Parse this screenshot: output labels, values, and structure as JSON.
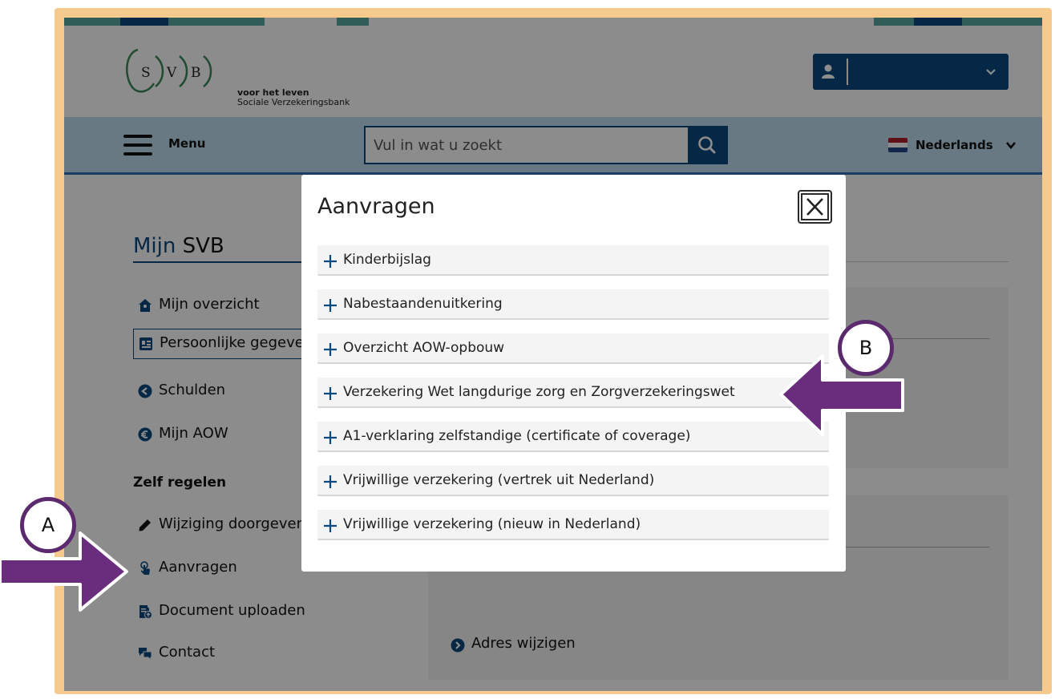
{
  "header": {
    "logo": {
      "letters": [
        "S",
        "V",
        "B"
      ],
      "tagline": "voor het leven",
      "org_name": "Sociale Verzekeringsbank"
    },
    "user_menu": {
      "icon": "user-icon",
      "chevron": "chevron-down-icon"
    }
  },
  "navbar": {
    "menu_label": "Menu",
    "search_placeholder": "Vul in wat u zoekt",
    "language_label": "Nederlands"
  },
  "sidebar": {
    "title_prefix": "Mijn",
    "title_strong": "SVB",
    "items": [
      {
        "label": "Mijn overzicht",
        "icon": "home-icon"
      },
      {
        "label": "Persoonlijke gegeve",
        "icon": "id-card-icon"
      },
      {
        "label": "Schulden",
        "icon": "arrow-left-circle-icon"
      },
      {
        "label": "Mijn AOW",
        "icon": "euro-circle-icon"
      }
    ],
    "section_title": "Zelf regelen",
    "self_service": [
      {
        "label": "Wijziging doorgeven",
        "icon": "pencil-icon"
      },
      {
        "label": "Aanvragen",
        "icon": "hand-pointer-icon"
      },
      {
        "label": "Document uploaden",
        "icon": "document-upload-icon"
      },
      {
        "label": "Contact",
        "icon": "chat-icon"
      }
    ]
  },
  "main": {
    "link_adres": "Adres wijzigen"
  },
  "modal": {
    "title": "Aanvragen",
    "close_icon": "close-icon",
    "items": [
      "Kinderbijslag",
      "Nabestaandenuitkering",
      "Overzicht AOW-opbouw",
      "Verzekering Wet langdurige zorg en Zorgverzekeringswet",
      "A1-verklaring zelfstandige (certificate of coverage)",
      "Vrijwillige verzekering (vertrek uit Nederland)",
      "Vrijwillige verzekering (nieuw in Nederland)"
    ]
  },
  "annotations": {
    "marker_a": "A",
    "marker_b": "B"
  },
  "colors": {
    "brand_blue": "#0a4a80",
    "nav_blue": "#bfdcef",
    "annotation_purple": "#6a2c7c",
    "frame": "#f6c98c"
  }
}
